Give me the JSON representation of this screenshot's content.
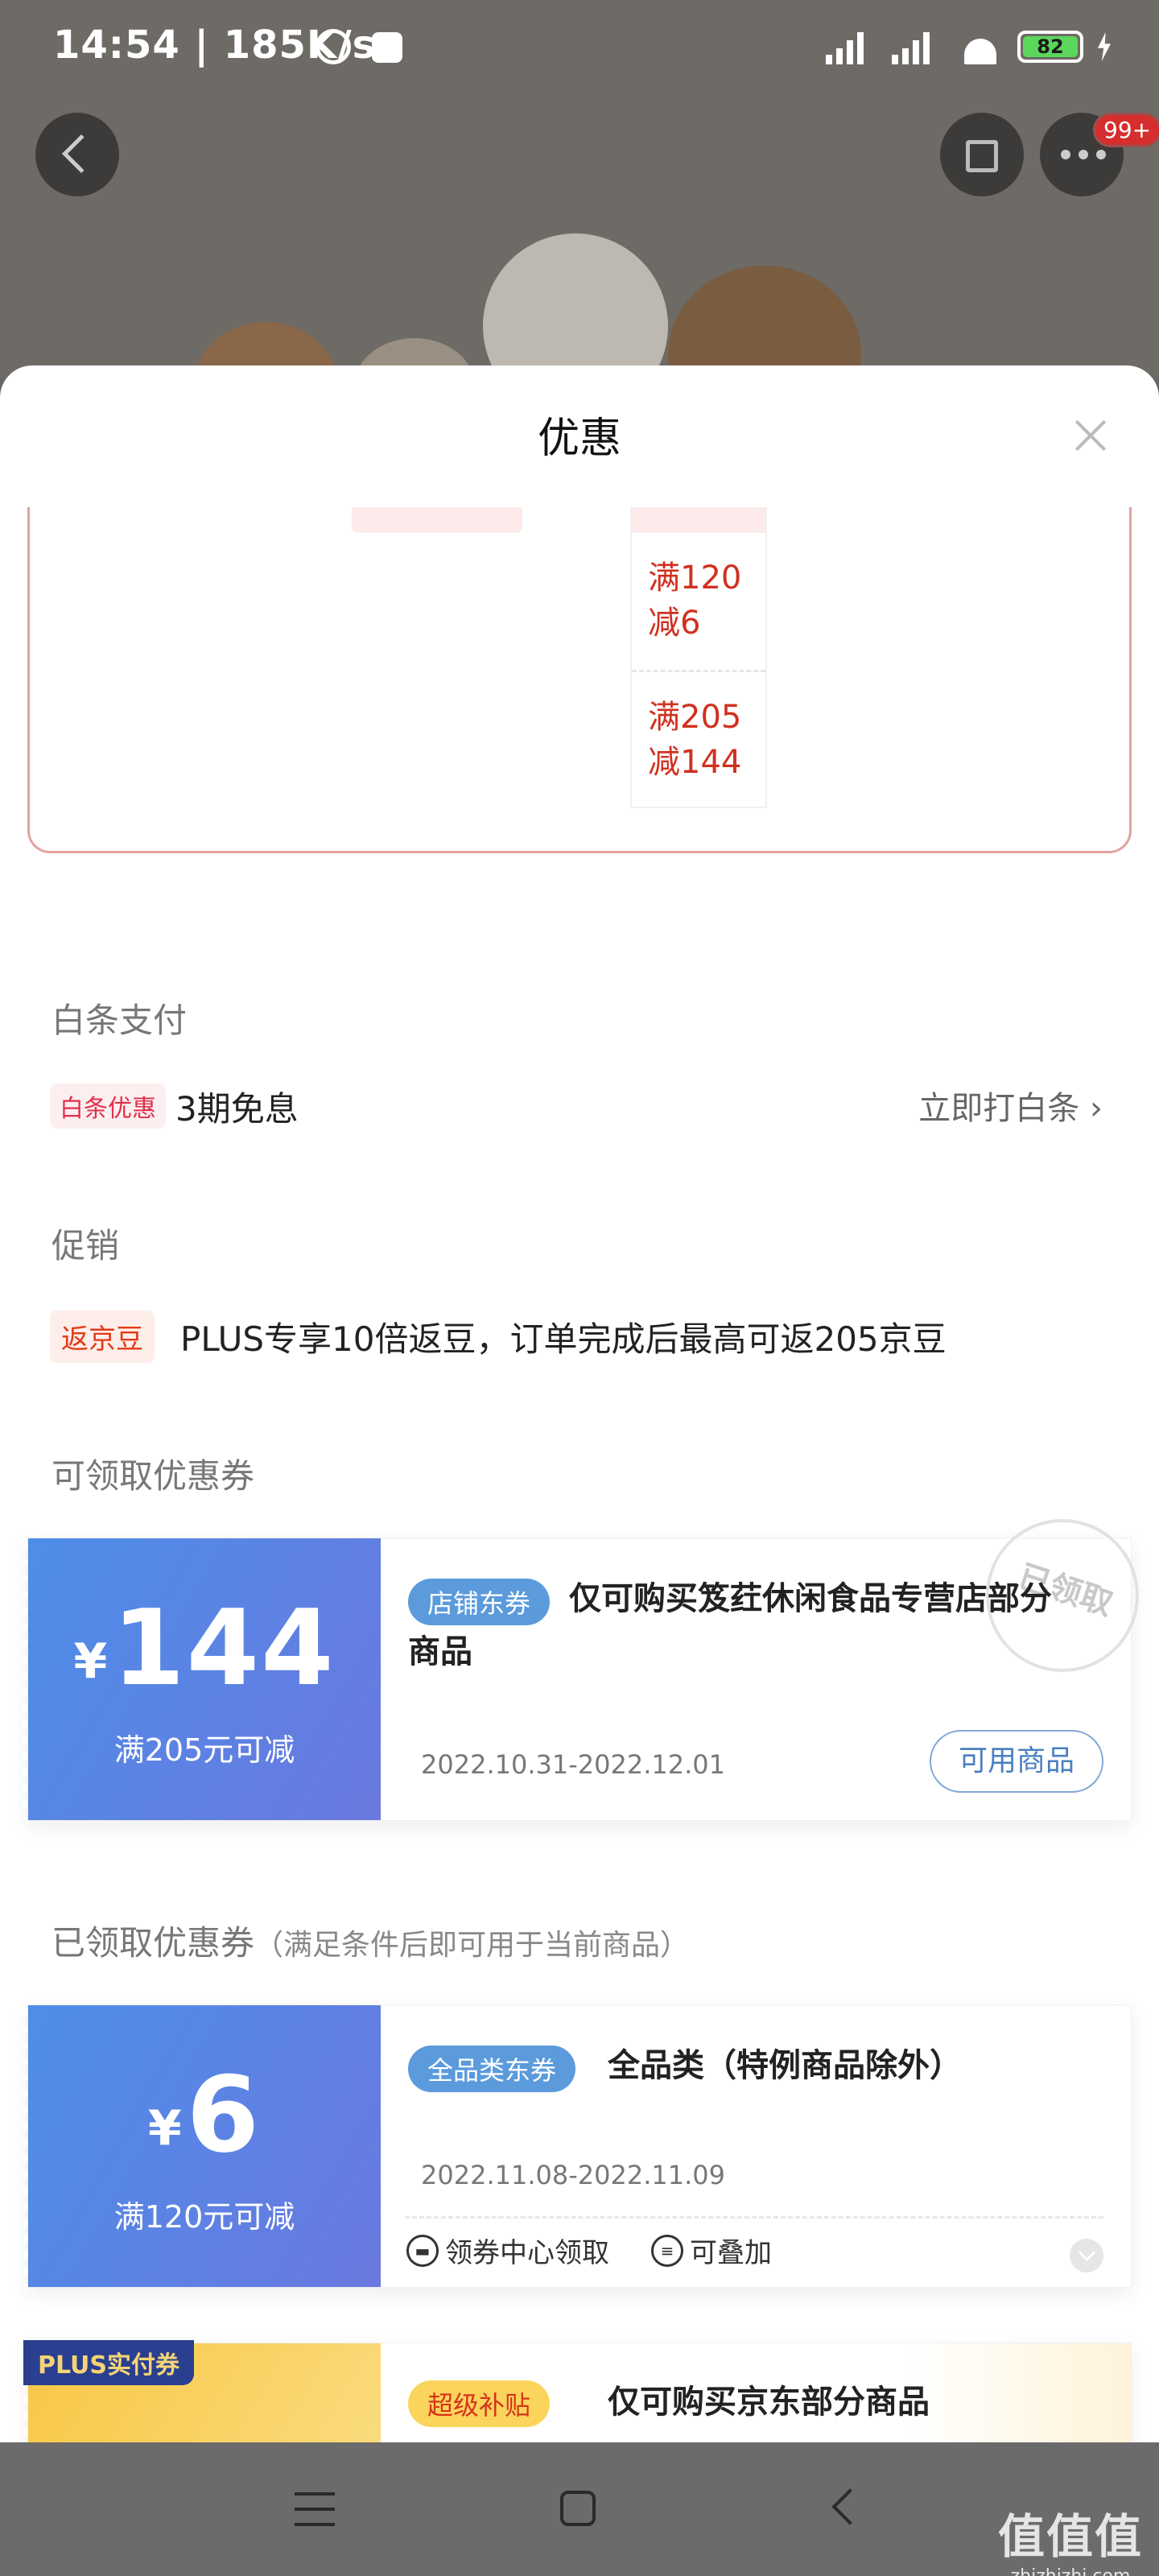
{
  "status_bar": {
    "time": "14:54 | 185K/s",
    "battery": "82"
  },
  "sheet": {
    "title": "优惠"
  },
  "price_table": {
    "rows": [
      "满120\n减6",
      "满205\n减144"
    ]
  },
  "baitiao": {
    "section_title": "白条支付",
    "tag": "白条优惠",
    "text": "3期免息",
    "link": "立即打白条"
  },
  "promo": {
    "section_title": "促销",
    "tag": "返京豆",
    "text": "PLUS专享10倍返豆，订单完成后最高可返205京豆"
  },
  "available_coupons": {
    "section_title": "可领取优惠券",
    "coupon": {
      "currency": "¥",
      "amount": "144",
      "condition": "满205元可减",
      "type_tag": "店铺东券",
      "description": "仅可购买笈荭休闲食品专营店部分商品",
      "dates": "2022.10.31-2022.12.01",
      "button": "可用商品",
      "stamp": "已领取"
    }
  },
  "received_coupons": {
    "section_title": "已领取优惠券",
    "section_note": "（满足条件后即可用于当前商品）",
    "coupon1": {
      "currency": "¥",
      "amount": "6",
      "condition": "满120元可减",
      "type_tag": "全品类东券",
      "description": "全品类（特例商品除外）",
      "dates": "2022.11.08-2022.11.09",
      "meta1": "领券中心领取",
      "meta2": "可叠加"
    },
    "coupon2": {
      "plus_tag": "PLUS实付券",
      "type_tag": "超级补贴",
      "description": "仅可购买京东部分商品"
    }
  },
  "watermark": {
    "line1": "值值值",
    "line2": "zhizhizhi.com"
  },
  "colors": {
    "accent_red": "#d0311f",
    "coupon_blue": "#5b9bdc",
    "plus_yellow": "#f7c745"
  }
}
